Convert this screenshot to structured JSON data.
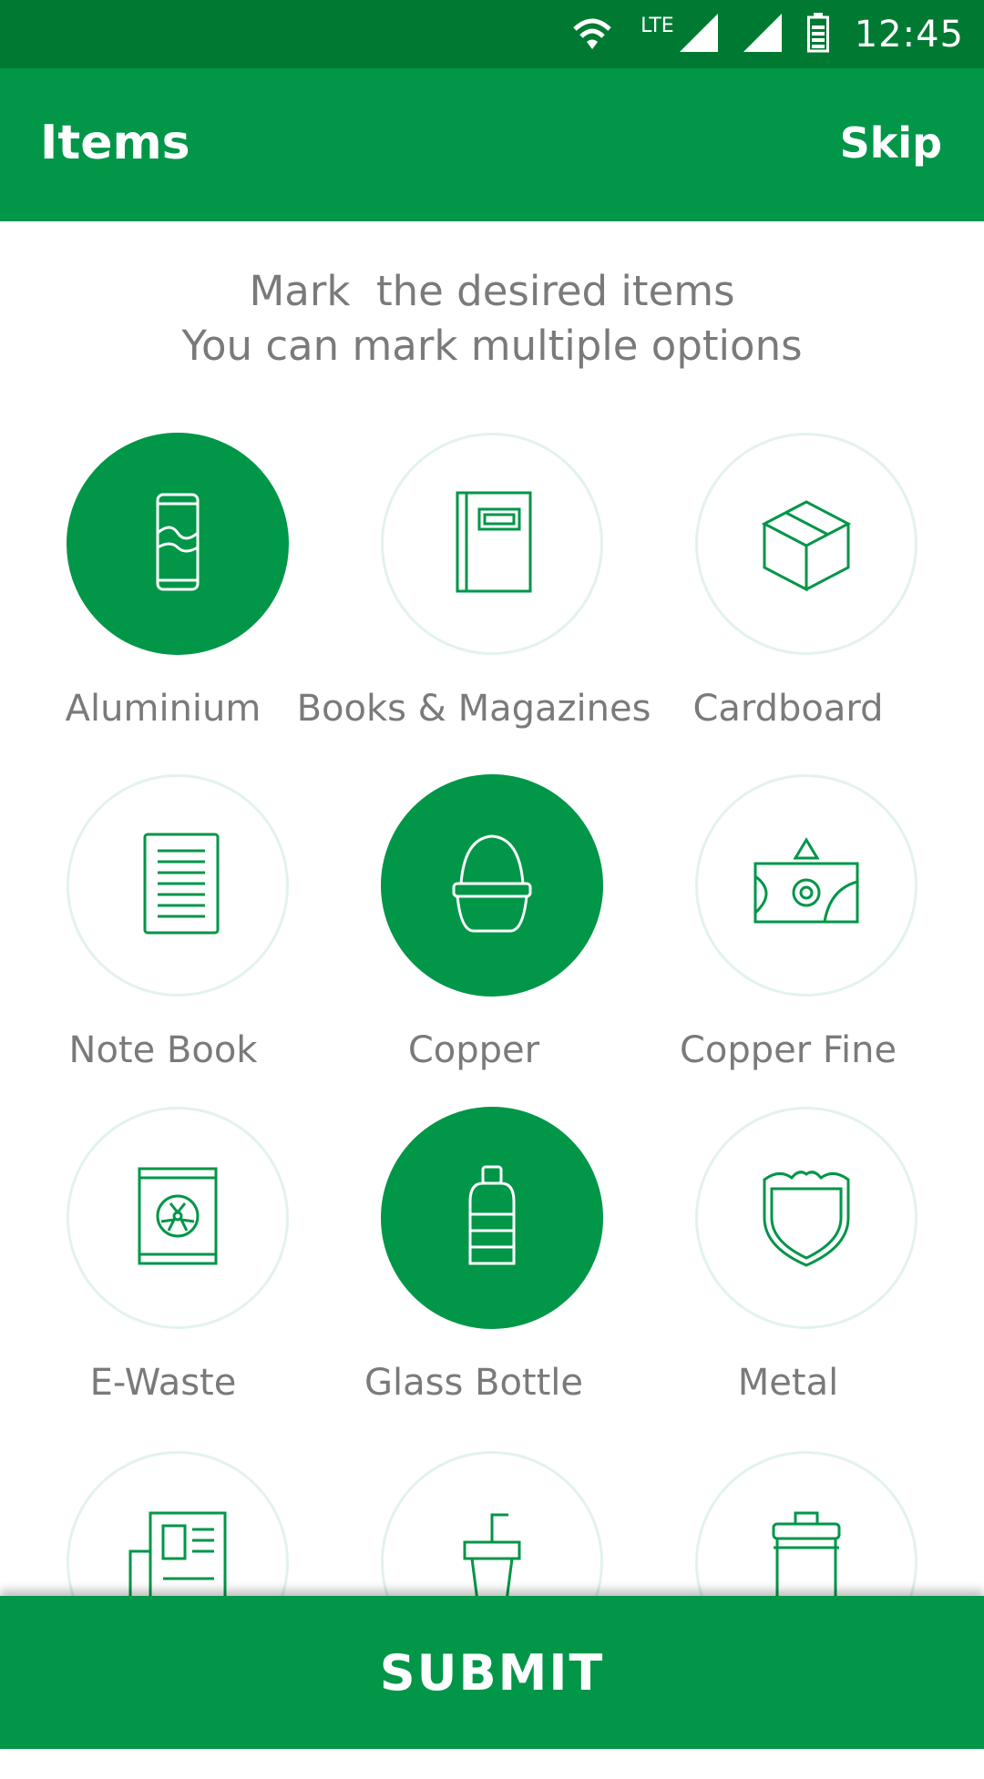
{
  "status_bar": {
    "network_label": "LTE",
    "time": "12:45"
  },
  "app_bar": {
    "title": "Items",
    "skip_label": "Skip"
  },
  "instructions": {
    "line1": "Mark  the desired items",
    "line2": "You can mark multiple options"
  },
  "items": [
    {
      "label": "Aluminium",
      "icon": "aluminium-can-icon",
      "selected": true
    },
    {
      "label": "Books & Magazines",
      "icon": "book-icon",
      "selected": false
    },
    {
      "label": "Cardboard",
      "icon": "cardboard-box-icon",
      "selected": false
    },
    {
      "label": "Note Book",
      "icon": "notebook-icon",
      "selected": false
    },
    {
      "label": "Copper",
      "icon": "copper-icon",
      "selected": true
    },
    {
      "label": "Copper Fine",
      "icon": "copper-fine-icon",
      "selected": false
    },
    {
      "label": "E-Waste",
      "icon": "e-waste-icon",
      "selected": false
    },
    {
      "label": "Glass Bottle",
      "icon": "glass-bottle-icon",
      "selected": true
    },
    {
      "label": "Metal",
      "icon": "metal-shield-icon",
      "selected": false
    },
    {
      "label": "",
      "icon": "newspaper-icon",
      "selected": false
    },
    {
      "label": "",
      "icon": "plastic-cup-icon",
      "selected": false
    },
    {
      "label": "",
      "icon": "trash-bin-icon",
      "selected": false
    }
  ],
  "submit_label": "SUBMIT",
  "colors": {
    "primary": "#019648",
    "status_bar": "#007a33",
    "text_gray": "#7a7a7a",
    "circle_border": "#e3f2ec"
  }
}
